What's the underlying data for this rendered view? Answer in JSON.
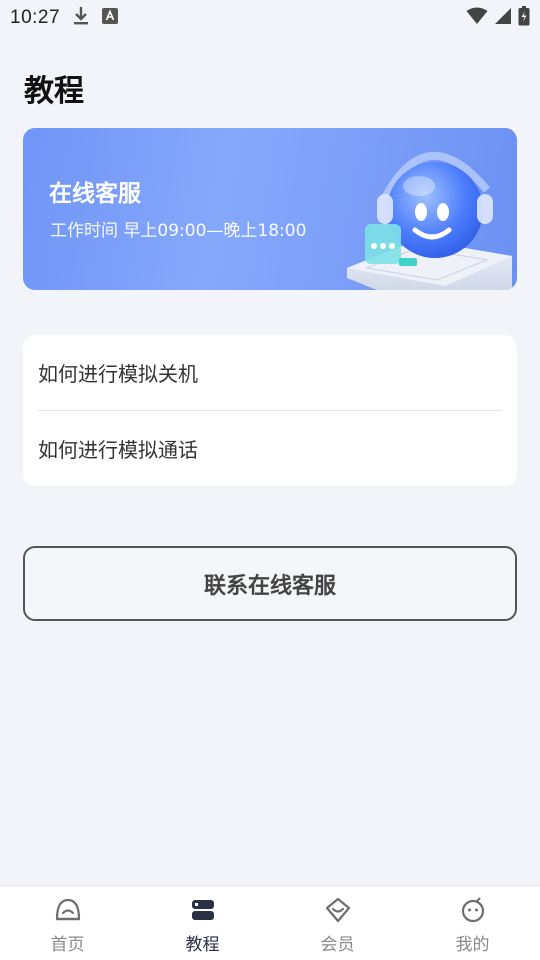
{
  "status_bar": {
    "time": "10:27",
    "icons": [
      "download-icon",
      "a-notification-icon",
      "wifi-icon",
      "signal-icon",
      "battery-icon"
    ]
  },
  "page": {
    "title": "教程"
  },
  "banner": {
    "title": "在线客服",
    "subtitle": "工作时间 早上09:00—晚上18:00"
  },
  "faq": {
    "items": [
      {
        "label": "如何进行模拟关机"
      },
      {
        "label": "如何进行模拟通话"
      }
    ]
  },
  "contact": {
    "label": "联系在线客服"
  },
  "bottom_nav": {
    "items": [
      {
        "label": "首页",
        "icon": "home-icon",
        "active": false
      },
      {
        "label": "教程",
        "icon": "tutorial-icon",
        "active": true
      },
      {
        "label": "会员",
        "icon": "member-icon",
        "active": false
      },
      {
        "label": "我的",
        "icon": "profile-icon",
        "active": false
      }
    ]
  },
  "colors": {
    "background": "#f3f4f9",
    "banner_start": "#6f95f7",
    "banner_end": "#6a90f2",
    "active_nav": "#2b3045",
    "inactive_nav": "#8a8a8e"
  }
}
